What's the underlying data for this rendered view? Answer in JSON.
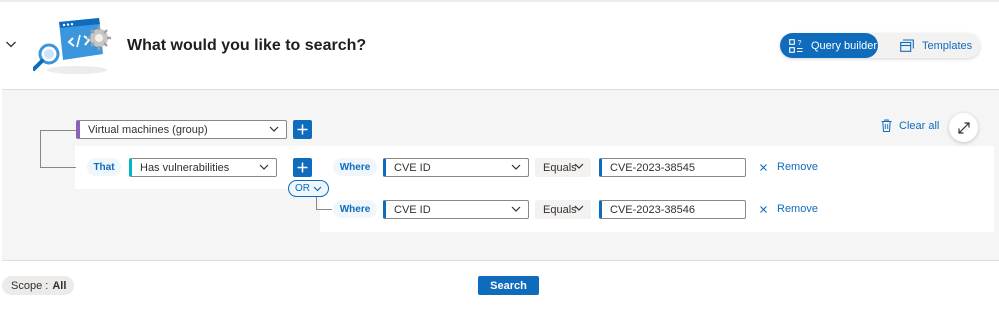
{
  "header": {
    "title": "What would you like to search?",
    "collapse_icon": "chevron-down-icon",
    "illustration_icon": "code-gear-magnifier-illustration"
  },
  "mode_toggle": {
    "query_builder_label": "Query builder",
    "query_builder_icon": "query-builder-icon",
    "templates_label": "Templates",
    "templates_icon": "templates-icon",
    "active": "Query builder"
  },
  "builder": {
    "root_entity": "Virtual machines (group)",
    "root_add_icon": "plus-icon",
    "clear_all_label": "Clear all",
    "clear_all_icon": "trash-icon",
    "expand_icon": "expand-icon",
    "relation": {
      "prefix": "That",
      "value": "Has vulnerabilities",
      "add_icon": "plus-icon"
    },
    "combinator": "OR",
    "conditions": [
      {
        "prefix": "Where",
        "field": "CVE ID",
        "operator": "Equals",
        "value": "CVE-2023-38545",
        "remove_label": "Remove"
      },
      {
        "prefix": "Where",
        "field": "CVE ID",
        "operator": "Equals",
        "value": "CVE-2023-38546",
        "remove_label": "Remove"
      }
    ]
  },
  "footer": {
    "scope_label": "Scope :",
    "scope_value": "All",
    "search_label": "Search"
  },
  "colors": {
    "accent": "#0f6cbd",
    "entity_marker": "#8764b8",
    "relation_marker": "#00b7c3",
    "panel_bg": "#f5f5f5"
  }
}
